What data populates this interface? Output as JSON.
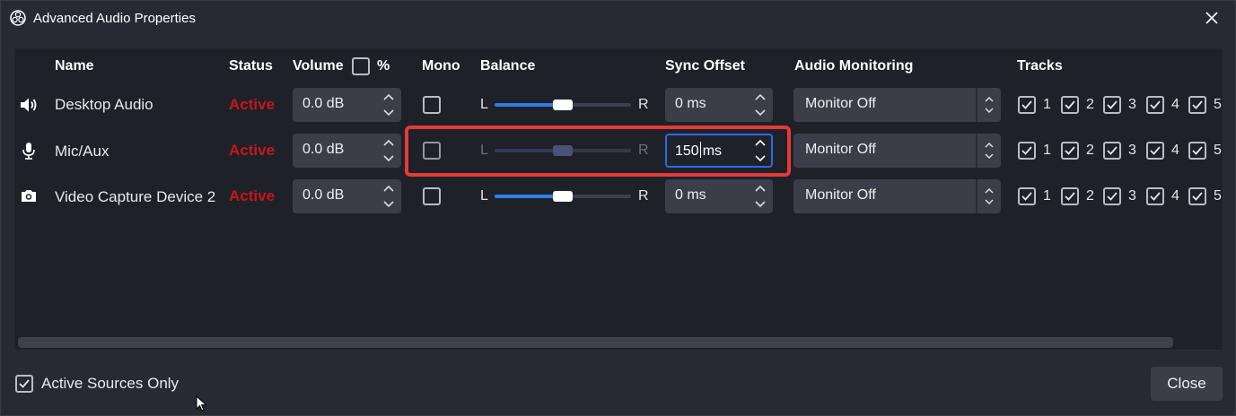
{
  "window": {
    "title": "Advanced Audio Properties"
  },
  "headers": {
    "name": "Name",
    "status": "Status",
    "volume": "Volume",
    "percent": "%",
    "mono": "Mono",
    "balance": "Balance",
    "sync_offset": "Sync Offset",
    "audio_monitoring": "Audio Monitoring",
    "tracks": "Tracks"
  },
  "balance_labels": {
    "left": "L",
    "right": "R"
  },
  "rows": [
    {
      "icon": "speaker-icon",
      "name": "Desktop Audio",
      "status": "Active",
      "volume": "0.0 dB",
      "mono": false,
      "balance": 0.5,
      "sync_offset": "0 ms",
      "monitoring": "Monitor Off",
      "tracks": [
        "1",
        "2",
        "3",
        "4",
        "5"
      ]
    },
    {
      "icon": "microphone-icon",
      "name": "Mic/Aux",
      "status": "Active",
      "volume": "0.0 dB",
      "mono": false,
      "balance": 0.5,
      "sync_value": "150",
      "sync_unit": "ms",
      "monitoring": "Monitor Off",
      "tracks": [
        "1",
        "2",
        "3",
        "4",
        "5"
      ]
    },
    {
      "icon": "camera-icon",
      "name": "Video Capture Device 2",
      "status": "Active",
      "volume": "0.0 dB",
      "mono": false,
      "balance": 0.5,
      "sync_offset": "0 ms",
      "monitoring": "Monitor Off",
      "tracks": [
        "1",
        "2",
        "3",
        "4",
        "5"
      ]
    }
  ],
  "footer": {
    "active_sources_only": "Active Sources Only",
    "active_sources_checked": true,
    "close_button": "Close"
  },
  "colors": {
    "status_active": "#c8161a",
    "accent": "#2b7de9",
    "highlight": "#e53a37"
  }
}
